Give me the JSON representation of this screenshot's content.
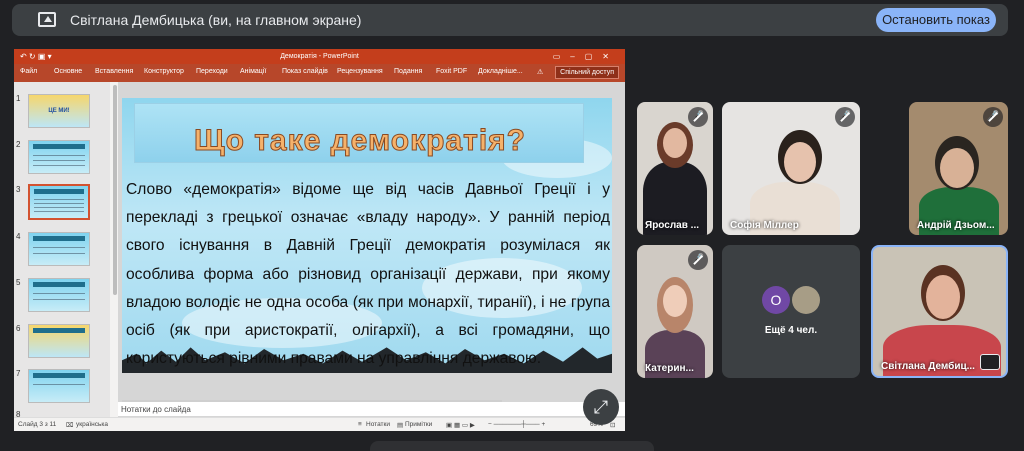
{
  "topbar": {
    "presenter_text": "Світлана Дембицька (ви, на главном экране)",
    "stop_button": "Остановить показ"
  },
  "ppt": {
    "window_title": "Демократія - PowerPoint",
    "ribbon_tabs": [
      "Файл",
      "Основне",
      "Вставлення",
      "Конструктор",
      "Переходи",
      "Анімації",
      "Показ слайдів",
      "Рецензування",
      "Подання",
      "Foxit PDF",
      "Докладніше...",
      "Спільний доступ"
    ],
    "thumb_numbers": [
      "1",
      "2",
      "3",
      "4",
      "5",
      "6",
      "7",
      "8"
    ],
    "thumb1_text": "ЦЕ МИ!",
    "slide_title": "Що таке демократія?",
    "slide_text": "Слово «демократія» відоме ще від часів Давньої Греції і у перекладі з грецької означає «владу народу». У ранній період свого існування в Давній Греції демократія розумілася як особлива форма або різновид організації держави, при якому владою володіє не одна особа (як при монархії, тиранії), і не група осіб (як при аристократії, олігархії), а всі громадяни, що користуються рівними правами на управління державою.",
    "notes_placeholder": "Нотатки до слайда",
    "status": {
      "slide": "Слайд 3 з 11",
      "lang": "українська",
      "notes": "Нотатки",
      "comments": "Примітки",
      "zoom": "69%"
    }
  },
  "participants": [
    {
      "name": "Ярослав ..."
    },
    {
      "name": "Софія Міллер"
    },
    {
      "name": "Андрій Дзьом..."
    },
    {
      "name": "Катерин..."
    },
    {
      "name": "Світлана Дембиц..."
    }
  ],
  "more_tile": {
    "avatar_letter": "O",
    "label": "Ещё 4 чел."
  }
}
